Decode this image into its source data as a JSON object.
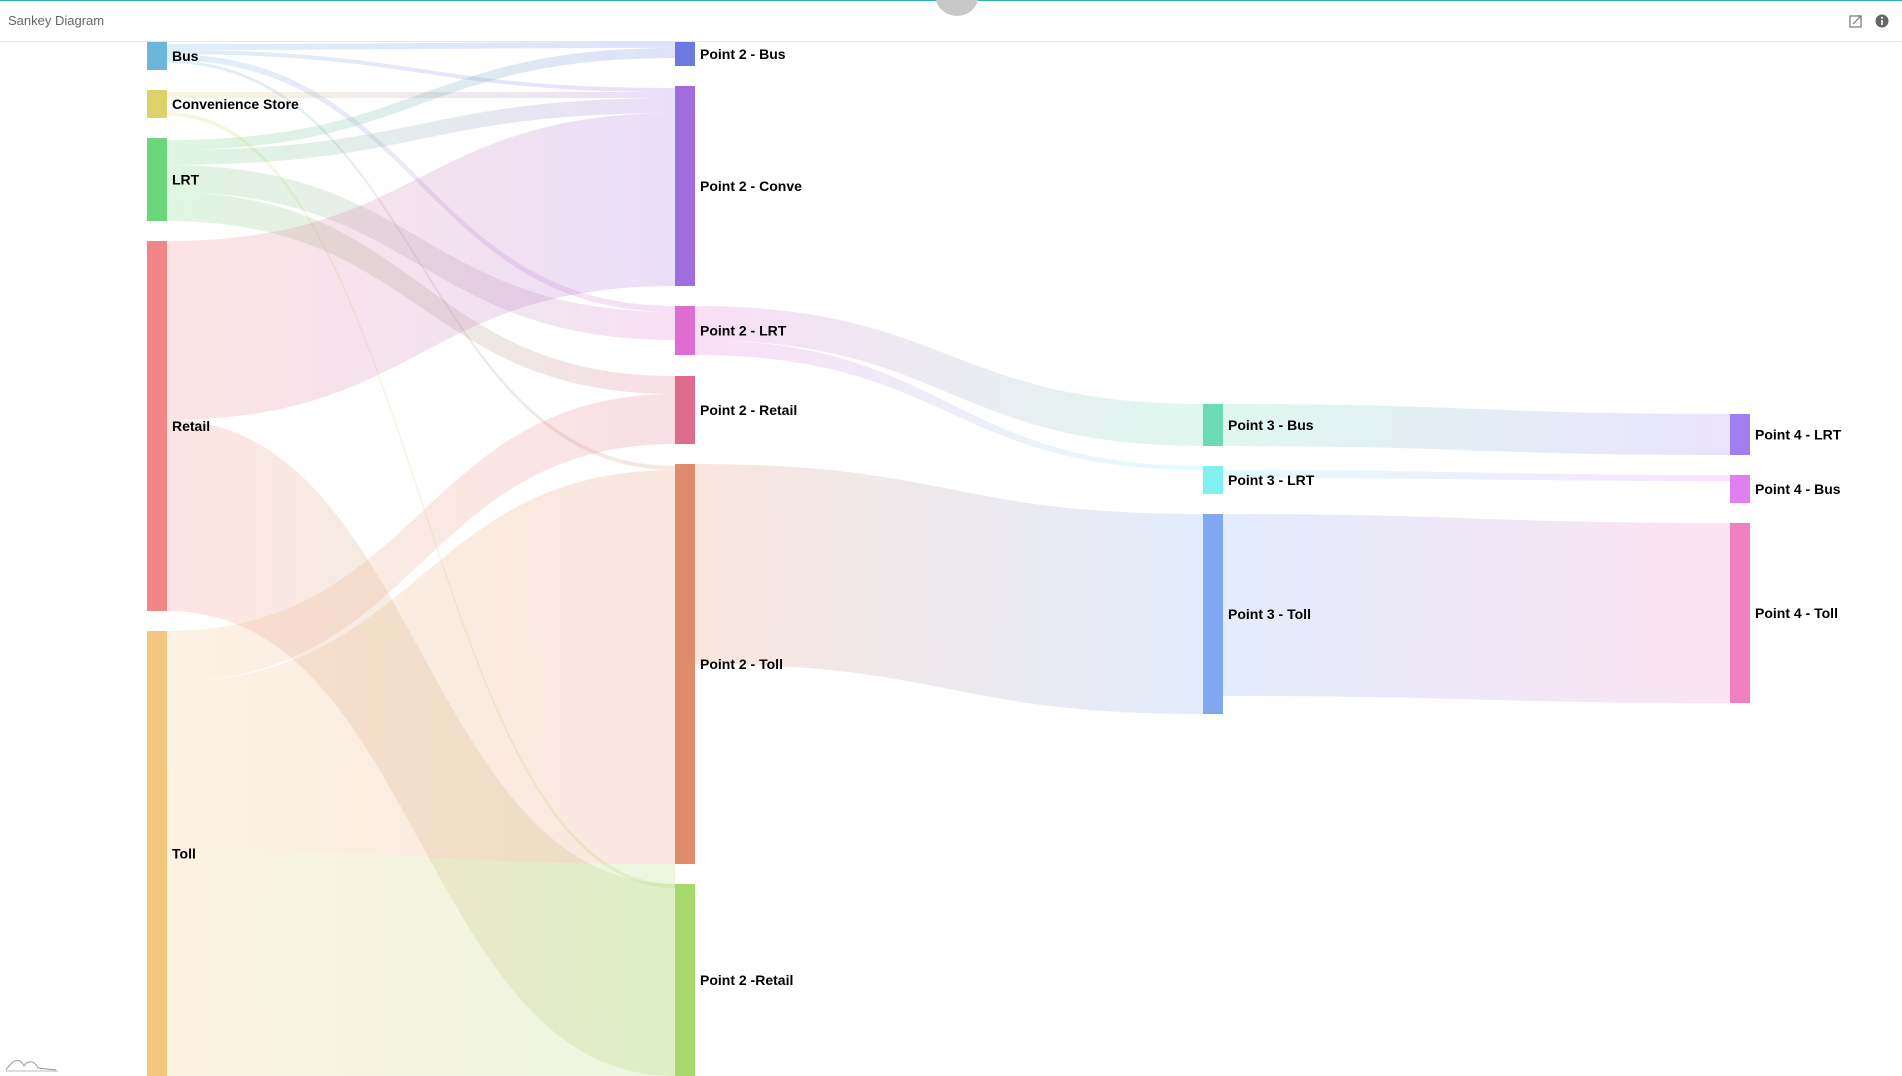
{
  "header": {
    "title": "Sankey Diagram",
    "icons": [
      "export-icon",
      "info-icon"
    ]
  },
  "diagram": {
    "type": "sankey",
    "nodes": [
      {
        "id": "bus",
        "label": "Bus",
        "color": "#6cb6dc"
      },
      {
        "id": "conv",
        "label": "Convenience Store",
        "color": "#dbd36a"
      },
      {
        "id": "lrt",
        "label": "LRT",
        "color": "#6cd67a"
      },
      {
        "id": "retail",
        "label": "Retail",
        "color": "#f28585"
      },
      {
        "id": "toll",
        "label": "Toll",
        "color": "#f4c77f"
      },
      {
        "id": "p2bus",
        "label": "Point 2 - Bus",
        "color": "#6c7adf"
      },
      {
        "id": "p2conv",
        "label": "Point 2 - Conve",
        "color": "#a06ddf"
      },
      {
        "id": "p2lrt",
        "label": "Point 2 - LRT",
        "color": "#df6cd0"
      },
      {
        "id": "p2retail",
        "label": "Point 2 - Retail",
        "color": "#df6c8c"
      },
      {
        "id": "p2toll",
        "label": "Point 2 - Toll",
        "color": "#df8c6c"
      },
      {
        "id": "p2retail2",
        "label": "Point 2 -Retail",
        "color": "#a6d86a"
      },
      {
        "id": "p3bus",
        "label": "Point 3 - Bus",
        "color": "#6cdcb4"
      },
      {
        "id": "p3lrt",
        "label": "Point 3 - LRT",
        "color": "#80f0f0"
      },
      {
        "id": "p3toll",
        "label": "Point 3 - Toll",
        "color": "#80a8f0"
      },
      {
        "id": "p4lrt",
        "label": "Point 4 - LRT",
        "color": "#a080f0"
      },
      {
        "id": "p4bus",
        "label": "Point 4 - Bus",
        "color": "#e080f0"
      },
      {
        "id": "p4toll",
        "label": "Point 4 - Toll",
        "color": "#f080c0"
      }
    ],
    "links": [
      {
        "source": "bus",
        "target": "p2bus",
        "value": 1
      },
      {
        "source": "bus",
        "target": "p2conv",
        "value": 1
      },
      {
        "source": "bus",
        "target": "p2lrt",
        "value": 1
      },
      {
        "source": "bus",
        "target": "p2toll",
        "value": 1
      },
      {
        "source": "conv",
        "target": "p2conv",
        "value": 1
      },
      {
        "source": "conv",
        "target": "p2retail2",
        "value": 1
      },
      {
        "source": "lrt",
        "target": "p2bus",
        "value": 1
      },
      {
        "source": "lrt",
        "target": "p2conv",
        "value": 2
      },
      {
        "source": "lrt",
        "target": "p2lrt",
        "value": 3
      },
      {
        "source": "lrt",
        "target": "p2retail",
        "value": 2
      },
      {
        "source": "retail",
        "target": "p2conv",
        "value": 19
      },
      {
        "source": "retail",
        "target": "p2retail2",
        "value": 20
      },
      {
        "source": "toll",
        "target": "p2retail",
        "value": 5
      },
      {
        "source": "toll",
        "target": "p2toll",
        "value": 39
      },
      {
        "source": "toll",
        "target": "p2retail2",
        "value": 16
      },
      {
        "source": "p2lrt",
        "target": "p3bus",
        "value": 4
      },
      {
        "source": "p2lrt",
        "target": "p3lrt",
        "value": 1
      },
      {
        "source": "p2toll",
        "target": "p3toll",
        "value": 19
      },
      {
        "source": "p3bus",
        "target": "p4lrt",
        "value": 4
      },
      {
        "source": "p3lrt",
        "target": "p4bus",
        "value": 1
      },
      {
        "source": "p3toll",
        "target": "p4toll",
        "value": 18
      }
    ]
  }
}
